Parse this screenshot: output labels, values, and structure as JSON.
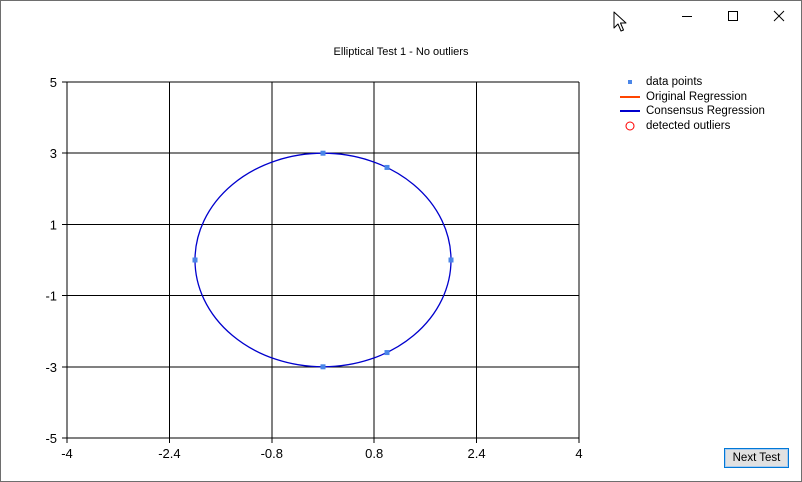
{
  "window": {
    "controls": [
      "minimize",
      "maximize",
      "close"
    ]
  },
  "chart_data": {
    "type": "scatter",
    "title": "Elliptical Test 1 - No outliers",
    "xlabel": "",
    "ylabel": "",
    "xlim": [
      -4,
      4
    ],
    "ylim": [
      -5,
      5
    ],
    "x_ticks": [
      -4,
      -2.4,
      -0.8,
      0.8,
      2.4,
      4
    ],
    "x_tick_labels": [
      "-4",
      "-2.4",
      "-0.8",
      "0.8",
      "2.4",
      "4"
    ],
    "y_ticks": [
      5,
      3,
      1,
      -1,
      -3,
      -5
    ],
    "y_tick_labels": [
      "5",
      "3",
      "1",
      "-1",
      "-3",
      "-5"
    ],
    "grid": true,
    "legend_position": "top-right",
    "legend": [
      {
        "label": "data points",
        "marker": "square",
        "color": "#4a86e8"
      },
      {
        "label": "Original Regression",
        "marker": "line",
        "color": "#ff4500"
      },
      {
        "label": "Consensus Regression",
        "marker": "line",
        "color": "#0000cd"
      },
      {
        "label": "detected outliers",
        "marker": "circle",
        "color": "#ff0000"
      }
    ],
    "series": [
      {
        "name": "data points",
        "type": "scatter",
        "color": "#4a86e8",
        "points": [
          {
            "x": 0,
            "y": 3
          },
          {
            "x": 1,
            "y": 2.6
          },
          {
            "x": 2,
            "y": 0
          },
          {
            "x": 1,
            "y": -2.6
          },
          {
            "x": 0,
            "y": -3
          },
          {
            "x": -2,
            "y": 0
          }
        ]
      },
      {
        "name": "Consensus Regression",
        "type": "ellipse",
        "color": "#0000cd",
        "center": [
          0,
          0
        ],
        "radius_x": 2,
        "radius_y": 3
      },
      {
        "name": "detected outliers",
        "type": "scatter",
        "color": "#ff0000",
        "points": []
      }
    ]
  },
  "buttons": {
    "next_test": "Next Test"
  }
}
